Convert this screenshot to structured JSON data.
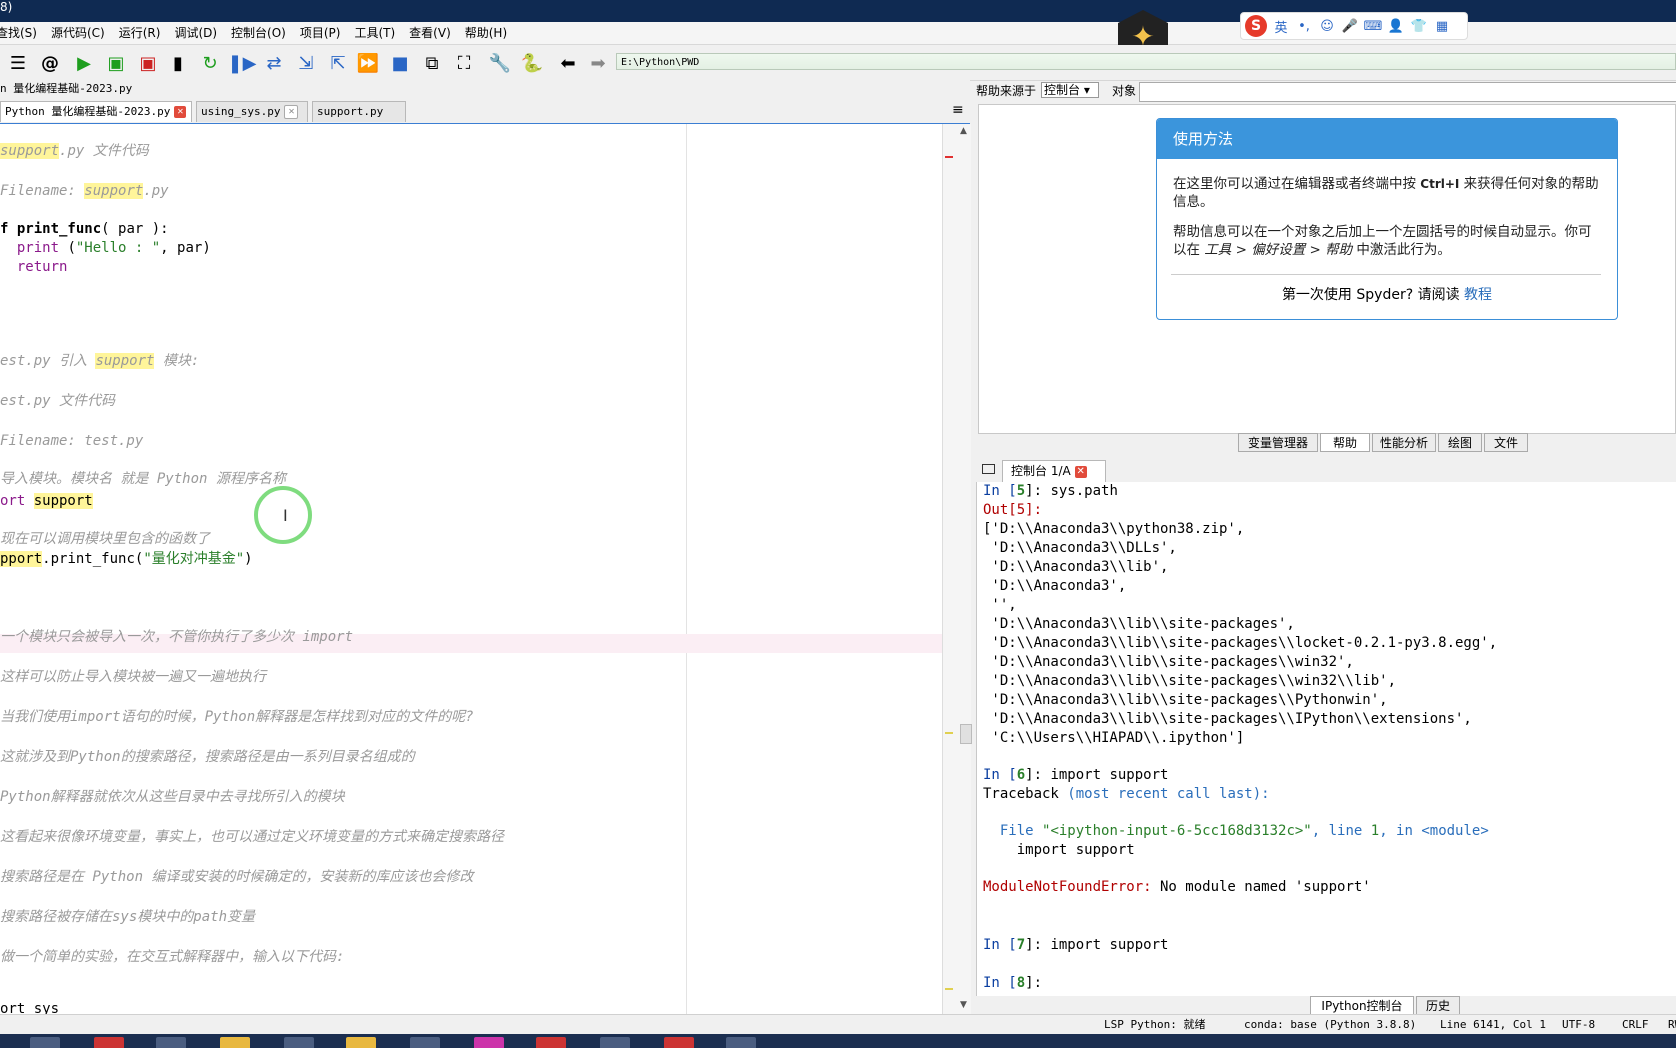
{
  "window": {
    "title_fragment": "8)"
  },
  "menu": [
    "查找(S)",
    "源代码(C)",
    "运行(R)",
    "调试(D)",
    "控制台(O)",
    "项目(P)",
    "工具(T)",
    "查看(V)",
    "帮助(H)"
  ],
  "toolbar": {
    "path": "E:\\Python\\PWD",
    "icons": [
      "list-icon",
      "at-icon",
      "run-icon",
      "run-cell-icon",
      "run-cell-advance-icon",
      "run-selection-icon",
      "rerun-icon",
      "debug-icon",
      "step-icon",
      "step-into-icon",
      "step-return-icon",
      "continue-icon",
      "stop-icon",
      "maximize-pane-icon",
      "fullscreen-icon",
      "preferences-icon",
      "pythonpath-icon",
      "back-icon",
      "forward-icon"
    ]
  },
  "ime": {
    "lang": "英",
    "punct": "•,",
    "colors": {
      "logo": "#e63a2a",
      "icons": "#2a66c5"
    }
  },
  "editor": {
    "filepath": "n 量化编程基础-2023.py",
    "tabs": [
      {
        "label": "Python 量化编程基础-2023.py",
        "active": true
      },
      {
        "label": "using_sys.py",
        "active": false
      },
      {
        "label": "support.py",
        "active": false
      }
    ],
    "lines": {
      "l1a": "support",
      "l1b": ".py 文件代码",
      "l2a": "Filename: ",
      "l2b": "support",
      "l2c": ".py",
      "l3a": "f ",
      "l3b": "print_func",
      "l3c": "( par ):",
      "l4a": "  ",
      "l4b": "print",
      "l4c": " (",
      "l4d": "\"Hello : \"",
      "l4e": ", par)",
      "l5a": "  ",
      "l5b": "return",
      "l6a": "est.py 引入 ",
      "l6b": "support",
      "l6c": " 模块:",
      "l7": "est.py 文件代码",
      "l8": "Filename: test.py",
      "l9": "导入模块。模块名 就是 Python 源程序名称",
      "l10a": "ort ",
      "l10b": "support",
      "l11": "现在可以调用模块里包含的函数了",
      "l12a": "pport",
      "l12b": ".print_func(",
      "l12c": "\"量化对冲基金\"",
      "l12d": ")",
      "l13": "一个模块只会被导入一次，不管你执行了多少次 import",
      "l14": "这样可以防止导入模块被一遍又一遍地执行",
      "l15": "当我们使用import语句的时候，Python解释器是怎样找到对应的文件的呢?",
      "l16": "这就涉及到Python的搜索路径，搜索路径是由一系列目录名组成的",
      "l17": "Python解释器就依次从这些目录中去寻找所引入的模块",
      "l18": "这看起来很像环境变量，事实上，也可以通过定义环境变量的方式来确定搜索路径",
      "l19": "搜索路径是在 Python 编译或安装的时候确定的，安装新的库应该也会修改",
      "l20": "搜索路径被存储在sys模块中的path变量",
      "l21": "做一个简单的实验，在交互式解释器中，输入以下代码:",
      "l22": "ort sys"
    }
  },
  "help": {
    "source_label": "帮助来源于",
    "source_value": "控制台",
    "object_label": "对象",
    "box_title": "使用方法",
    "p1a": "在这里你可以通过在编辑器或者终端中按 ",
    "p1b": "Ctrl+I",
    "p1c": " 来获得任何对象的帮助信息。",
    "p2a": "帮助信息可以在一个对象之后加上一个左圆括号的时候自动显示。你可以在 ",
    "p2b": "工具 > 偏好设置 > 帮助",
    "p2c": " 中激活此行为。",
    "p3a": "第一次使用 Spyder? 请阅读 ",
    "p3b": "教程"
  },
  "pane_tabs": [
    {
      "label": "变量管理器",
      "active": false
    },
    {
      "label": "帮助",
      "active": true
    },
    {
      "label": "性能分析",
      "active": false
    },
    {
      "label": "绘图",
      "active": false
    },
    {
      "label": "文件",
      "active": false
    }
  ],
  "console": {
    "tab_label": "控制台 1/A",
    "lines": {
      "c1a": "In [",
      "c1b": "5",
      "c1c": "]: sys.path",
      "c2a": "Out[",
      "c2b": "5",
      "c2c": "]:",
      "c3": "['D:\\\\Anaconda3\\\\python38.zip',",
      "c4": " 'D:\\\\Anaconda3\\\\DLLs',",
      "c5": " 'D:\\\\Anaconda3\\\\lib',",
      "c6": " 'D:\\\\Anaconda3',",
      "c7": " '',",
      "c8": " 'D:\\\\Anaconda3\\\\lib\\\\site-packages',",
      "c9": " 'D:\\\\Anaconda3\\\\lib\\\\site-packages\\\\locket-0.2.1-py3.8.egg',",
      "c10": " 'D:\\\\Anaconda3\\\\lib\\\\site-packages\\\\win32',",
      "c11": " 'D:\\\\Anaconda3\\\\lib\\\\site-packages\\\\win32\\\\lib',",
      "c12": " 'D:\\\\Anaconda3\\\\lib\\\\site-packages\\\\Pythonwin',",
      "c13": " 'D:\\\\Anaconda3\\\\lib\\\\site-packages\\\\IPython\\\\extensions',",
      "c14": " 'C:\\\\Users\\\\HIAPAD\\\\.ipython']",
      "c15a": "In [",
      "c15b": "6",
      "c15c": "]: import support",
      "c16a": "Traceback ",
      "c16b": "(most recent call last):",
      "c17a": "  File ",
      "c17b": "\"<ipython-input-6-5cc168d3132c>\"",
      "c17c": ", line ",
      "c17d": "1",
      "c17e": ", in ",
      "c17f": "<module>",
      "c18": "    import support",
      "c19a": "ModuleNotFoundError:",
      "c19b": " No module named 'support'",
      "c20a": "In [",
      "c20b": "7",
      "c20c": "]: import support",
      "c21a": "In [",
      "c21b": "8",
      "c21c": "]:"
    }
  },
  "bottom_tabs": [
    {
      "label": "IPython控制台",
      "active": true
    },
    {
      "label": "历史",
      "active": false
    }
  ],
  "status": {
    "lsp": "LSP Python: 就绪",
    "conda": "conda: base (Python 3.8.8)",
    "position": "Line 6141, Col 1",
    "encoding": "UTF-8",
    "eol": "CRLF",
    "rw": "RW"
  }
}
